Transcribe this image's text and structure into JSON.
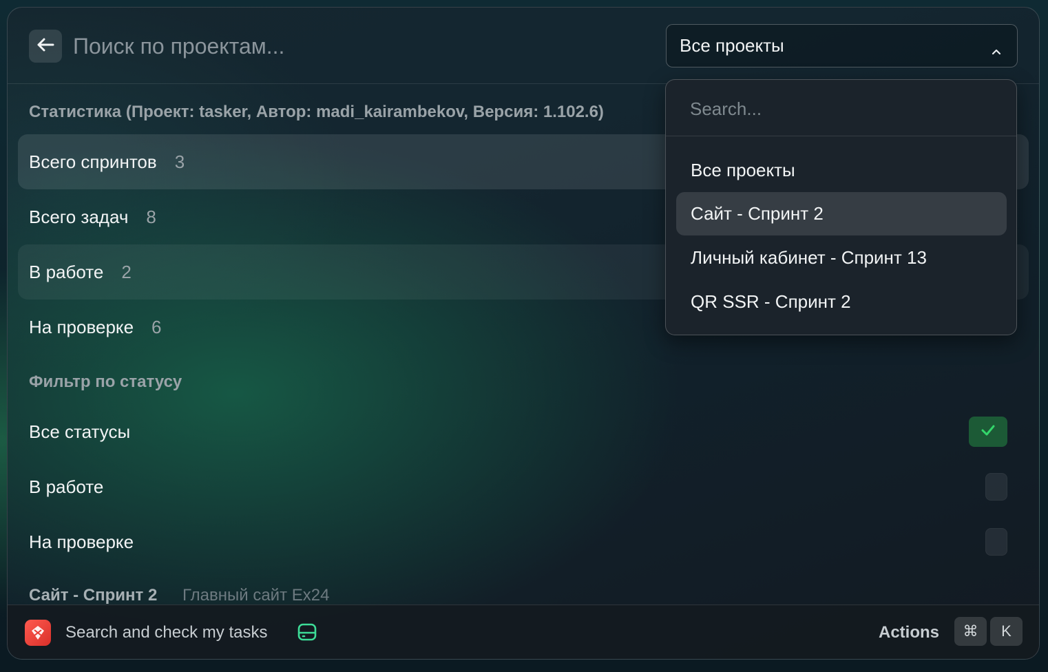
{
  "header": {
    "search_placeholder": "Поиск по проектам...",
    "project_select": {
      "selected": "Все проекты"
    }
  },
  "stats": {
    "title": "Статистика (Проект: tasker, Автор: madi_kairambekov, Версия: 1.102.6)",
    "items": [
      {
        "label": "Всего спринтов",
        "count": "3"
      },
      {
        "label": "Всего задач",
        "count": "8"
      },
      {
        "label": "В работе",
        "count": "2"
      },
      {
        "label": "На проверке",
        "count": "6"
      }
    ]
  },
  "filter": {
    "title": "Фильтр по статусу",
    "items": [
      {
        "label": "Все статусы",
        "checked": true
      },
      {
        "label": "В работе",
        "checked": false
      },
      {
        "label": "На проверке",
        "checked": false
      }
    ]
  },
  "sprint_section": {
    "title": "Сайт - Спринт 2",
    "subtitle": "Главный сайт Ex24"
  },
  "dropdown": {
    "search_placeholder": "Search...",
    "options": [
      {
        "label": "Все проекты",
        "active": false
      },
      {
        "label": "Сайт - Спринт 2",
        "active": true
      },
      {
        "label": "Личный кабинет - Спринт 13",
        "active": false
      },
      {
        "label": "QR SSR - Спринт 2",
        "active": false
      }
    ]
  },
  "footer": {
    "title": "Search and check my tasks",
    "actions_label": "Actions",
    "shortcut_keys": [
      "⌘",
      "K"
    ]
  },
  "colors": {
    "check_on_bg": "#1c5a36",
    "check_on_mark": "#33d66b",
    "app_icon": "#e83a33",
    "hdd_icon": "#3ddc97"
  }
}
